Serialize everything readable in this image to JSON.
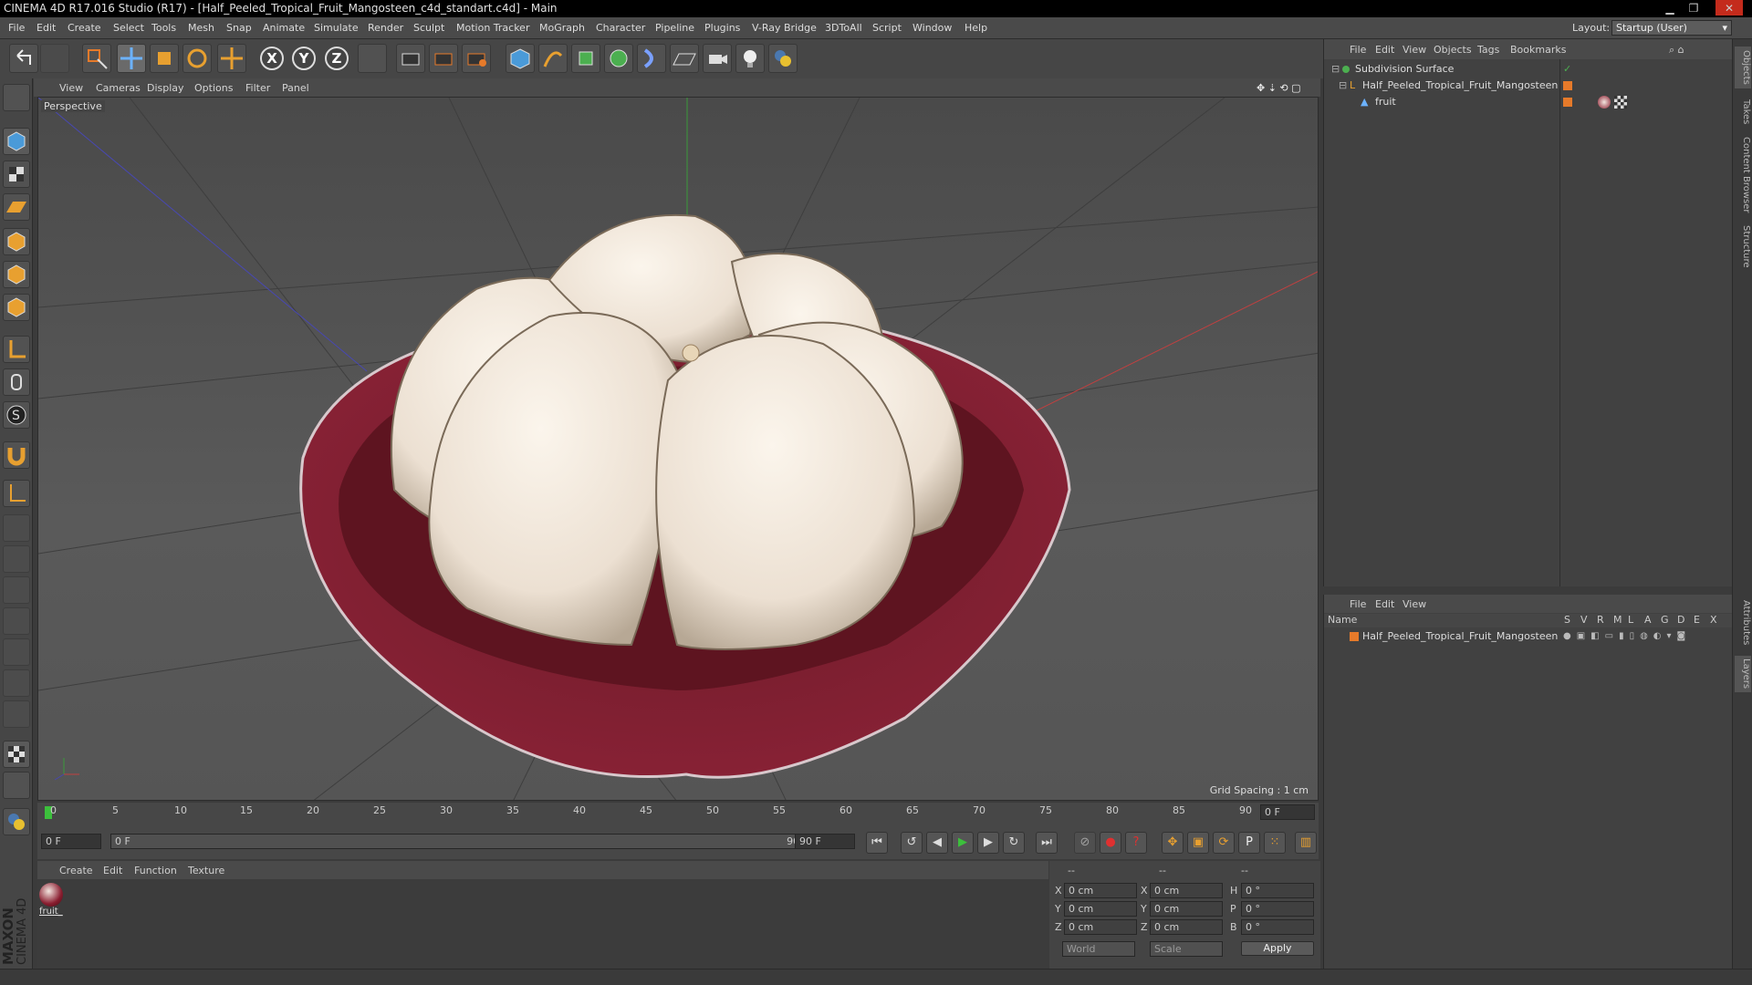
{
  "title": "CINEMA 4D R17.016 Studio (R17) - [Half_Peeled_Tropical_Fruit_Mangosteen_c4d_standart.c4d] - Main",
  "menu": [
    "File",
    "Edit",
    "Create",
    "Select",
    "Tools",
    "Mesh",
    "Snap",
    "Animate",
    "Simulate",
    "Render",
    "Sculpt",
    "Motion Tracker",
    "MoGraph",
    "Character",
    "Pipeline",
    "Plugins",
    "V-Ray Bridge",
    "3DToAll",
    "Script",
    "Window",
    "Help"
  ],
  "layout": {
    "label": "Layout:",
    "value": "Startup (User)"
  },
  "axis": [
    "X",
    "Y",
    "Z"
  ],
  "viewport_menu": [
    "View",
    "Cameras",
    "Display",
    "Options",
    "Filter",
    "Panel"
  ],
  "viewport_label": "Perspective",
  "grid_spacing": "Grid Spacing : 1 cm",
  "timeline": {
    "ticks": [
      "0",
      "5",
      "10",
      "15",
      "20",
      "25",
      "30",
      "35",
      "40",
      "45",
      "50",
      "55",
      "60",
      "65",
      "70",
      "75",
      "80",
      "85",
      "90"
    ],
    "current": "0 F",
    "start": "0 F",
    "range_start": "0 F",
    "range_end": "90 F",
    "end": "90 F"
  },
  "material_menu": [
    "Create",
    "Edit",
    "Function",
    "Texture"
  ],
  "material": {
    "name": "fruit_"
  },
  "coords": {
    "header": [
      "--",
      "--",
      "--"
    ],
    "rows": [
      {
        "a": "X",
        "av": "0 cm",
        "b": "X",
        "bv": "0 cm",
        "c": "H",
        "cv": "0 °"
      },
      {
        "a": "Y",
        "av": "0 cm",
        "b": "Y",
        "bv": "0 cm",
        "c": "P",
        "cv": "0 °"
      },
      {
        "a": "Z",
        "av": "0 cm",
        "b": "Z",
        "bv": "0 cm",
        "c": "B",
        "cv": "0 °"
      }
    ],
    "world": "World",
    "scale": "Scale",
    "apply": "Apply"
  },
  "objects_menu": [
    "File",
    "Edit",
    "View",
    "Objects",
    "Tags",
    "Bookmarks"
  ],
  "objects": [
    "Subdivision Surface",
    "Half_Peeled_Tropical_Fruit_Mangosteen",
    "fruit"
  ],
  "layers_menu": [
    "File",
    "Edit",
    "View"
  ],
  "layers_header": {
    "name": "Name",
    "cols": [
      "S",
      "V",
      "R",
      "M",
      "L",
      "A",
      "G",
      "D",
      "E",
      "X"
    ]
  },
  "layers": [
    "Half_Peeled_Tropical_Fruit_Mangosteen"
  ],
  "side_tabs": [
    "Objects",
    "Takes",
    "Content Browser",
    "Structure",
    "Attributes",
    "Layers"
  ],
  "brand": [
    "MAXON",
    "CINEMA 4D"
  ],
  "colors": {
    "accent": "#e67a2a",
    "skin": "#8a1e30",
    "flesh": "#f0e6da"
  }
}
